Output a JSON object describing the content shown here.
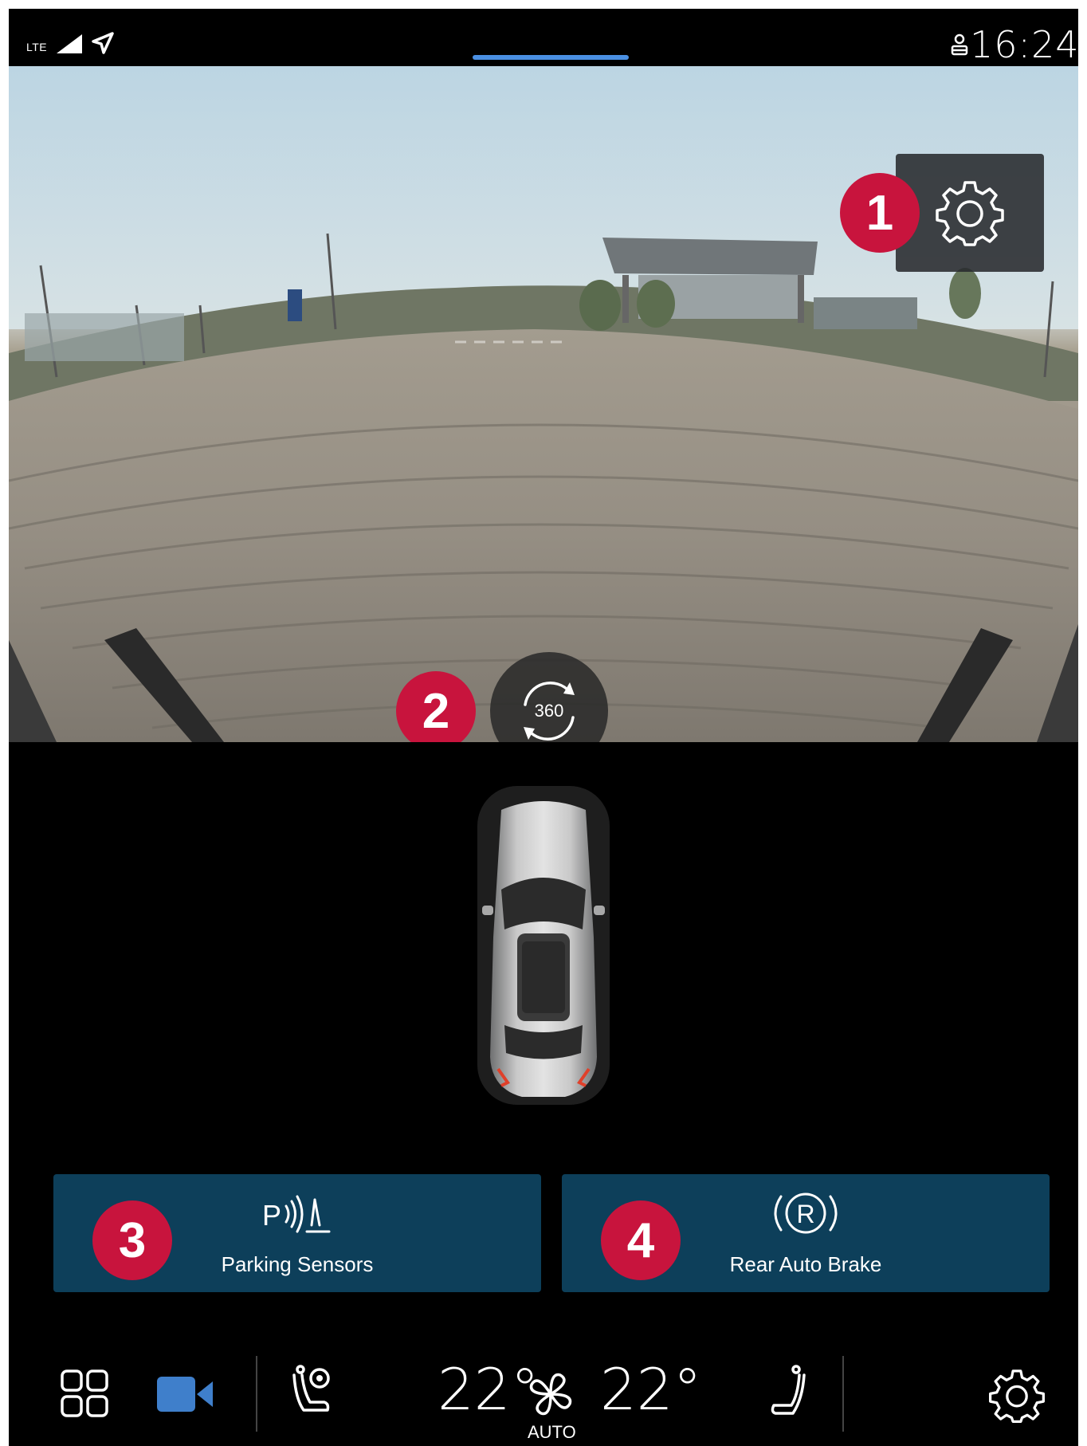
{
  "status_bar": {
    "network": "LTE",
    "time": "16:24"
  },
  "camera": {
    "badges": [
      "1",
      "2",
      "3",
      "4"
    ],
    "view_button_label": "360"
  },
  "tiles": {
    "parking_sensors": {
      "label": "Parking Sensors",
      "icon": "parking-sensor-icon"
    },
    "rear_auto_brake": {
      "label": "Rear Auto Brake",
      "icon": "rear-auto-brake-icon"
    }
  },
  "climate": {
    "left_temp": "22°",
    "right_temp": "22°",
    "fan_mode": "AUTO"
  },
  "colors": {
    "badge": "#c8143d",
    "tile": "#0d3f5a",
    "active_icon": "#3f7fcb",
    "handle": "#4a8fe2"
  }
}
